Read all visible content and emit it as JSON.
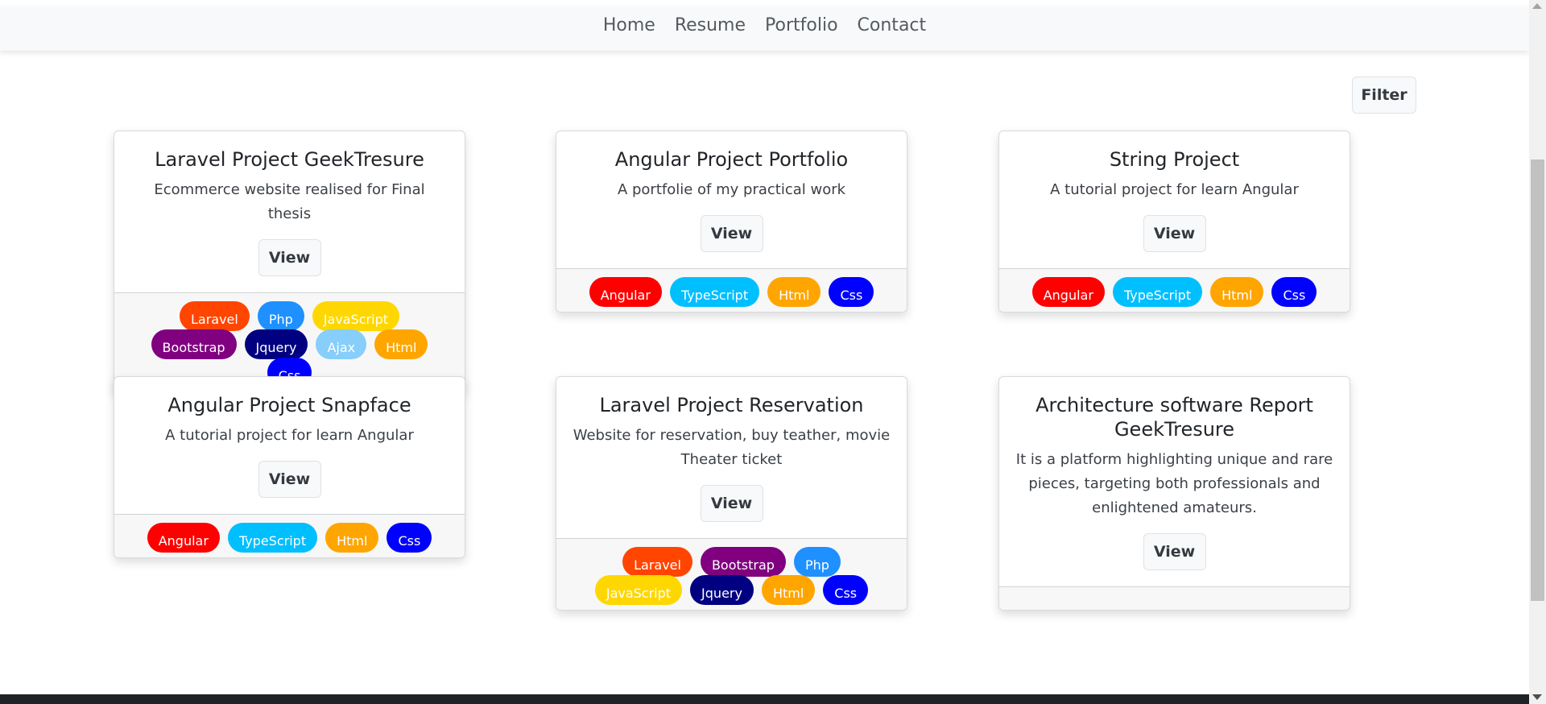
{
  "nav": {
    "items": [
      "Home",
      "Resume",
      "Portfolio",
      "Contact"
    ]
  },
  "filter_label": "Filter",
  "view_label": "View",
  "tag_colors": {
    "Laravel": "#ff4500",
    "Php": "#1e90ff",
    "JavaScript": "#ffd700",
    "Bootstrap": "#800080",
    "Jquery": "#000080",
    "Ajax": "#87cefa",
    "Html": "#ffa500",
    "Css": "#0000ff",
    "Angular": "#ff0000",
    "TypeScript": "#00bfff"
  },
  "projects": [
    {
      "title": "Laravel Project GeekTresure",
      "description": "Ecommerce website realised for Final thesis",
      "tags": [
        "Laravel",
        "Php",
        "JavaScript",
        "Bootstrap",
        "Jquery",
        "Ajax",
        "Html",
        "Css"
      ]
    },
    {
      "title": "Angular Project Portfolio",
      "description": "A portfolie of my practical work",
      "tags": [
        "Angular",
        "TypeScript",
        "Html",
        "Css"
      ]
    },
    {
      "title": "String Project",
      "description": "A tutorial project for learn Angular",
      "tags": [
        "Angular",
        "TypeScript",
        "Html",
        "Css"
      ]
    },
    {
      "title": "Angular Project Snapface",
      "description": "A tutorial project for learn Angular",
      "tags": [
        "Angular",
        "TypeScript",
        "Html",
        "Css"
      ]
    },
    {
      "title": "Laravel Project Reservation",
      "description": "Website for reservation, buy teather, movie Theater ticket",
      "tags": [
        "Laravel",
        "Bootstrap",
        "Php",
        "JavaScript",
        "Jquery",
        "Html",
        "Css"
      ]
    },
    {
      "title": "Architecture software Report GeekTresure",
      "description": "It is a platform highlighting unique and rare pieces, targeting both professionals and enlightened amateurs.",
      "tags": []
    }
  ]
}
